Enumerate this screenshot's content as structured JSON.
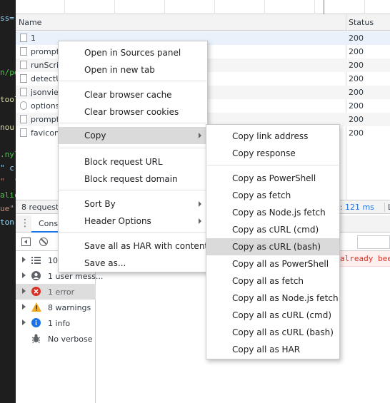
{
  "editor": {
    "lines": [
      {
        "text": "ss=",
        "color": "#9cdcfe"
      },
      {
        "text": "n/pe",
        "color": "#4ec94e"
      },
      {
        "text": "tool",
        "color": "#dcdcaa"
      },
      {
        "text": "nou",
        "color": "#dcdcaa"
      },
      {
        "text": ".nyl",
        "color": "#4ec94e"
      },
      {
        "text": "\" c",
        "color": "#9cdcfe"
      },
      {
        "text": "\"  \"",
        "color": "#ce9178"
      },
      {
        "text": "alic",
        "color": "#4ec94e"
      },
      {
        "text": "ue\"",
        "color": "#ce9178"
      },
      {
        "text": "ton",
        "color": "#9cdcfe"
      }
    ]
  },
  "table": {
    "col_name": "Name",
    "col_status": "Status",
    "rows": [
      {
        "name": "1",
        "status": "200"
      },
      {
        "name": "prompt.",
        "status": "200"
      },
      {
        "name": "runScrip",
        "status": "200"
      },
      {
        "name": "detectU",
        "status": "200"
      },
      {
        "name": "jsonview",
        "status": "200"
      },
      {
        "name": "options.",
        "status": "200"
      },
      {
        "name": "prompt.",
        "status": "200"
      },
      {
        "name": "favicon.",
        "status": "200"
      }
    ]
  },
  "summary": {
    "requests": "8 requests",
    "finish": "ed: 121 ms",
    "extra": "L"
  },
  "drawer": {
    "tab_console": "Cons"
  },
  "console": {
    "error_text": "already been",
    "sidebar": [
      {
        "icon": "list-icon",
        "label": "10"
      },
      {
        "icon": "user-icon",
        "label": "1 user mess..."
      },
      {
        "icon": "error-icon",
        "label": "1 error"
      },
      {
        "icon": "warning-icon",
        "label": "8 warnings"
      },
      {
        "icon": "info-icon",
        "label": "1 info"
      },
      {
        "icon": "bug-icon",
        "label": "No verbose"
      }
    ]
  },
  "context_menu": {
    "items": [
      "Open in Sources panel",
      "Open in new tab",
      "Clear browser cache",
      "Clear browser cookies",
      "Copy",
      "Block request URL",
      "Block request domain",
      "Sort By",
      "Header Options",
      "Save all as HAR with content",
      "Save as..."
    ]
  },
  "copy_submenu": {
    "items": [
      "Copy link address",
      "Copy response",
      "Copy as PowerShell",
      "Copy as fetch",
      "Copy as Node.js fetch",
      "Copy as cURL (cmd)",
      "Copy as cURL (bash)",
      "Copy all as PowerShell",
      "Copy all as fetch",
      "Copy all as Node.js fetch",
      "Copy all as cURL (cmd)",
      "Copy all as cURL (bash)",
      "Copy all as HAR"
    ]
  },
  "colors": {
    "error_red": "#d93025",
    "warning_yellow": "#f2ab26",
    "info_blue": "#1a73e8",
    "highlight": "#dadada"
  }
}
